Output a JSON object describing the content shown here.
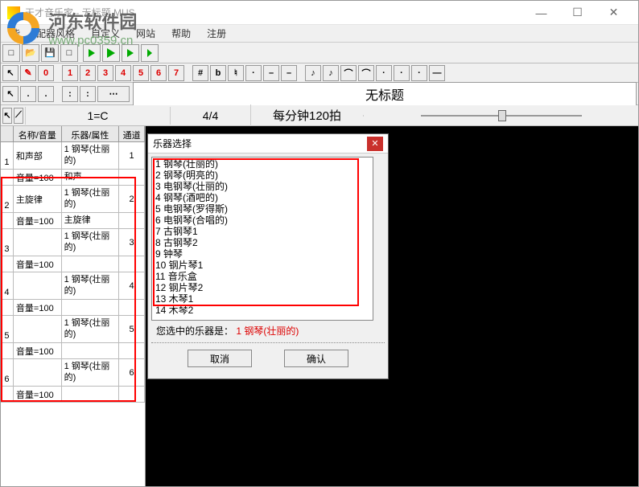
{
  "window": {
    "title": "天才音乐家 - 无标题.MUS"
  },
  "watermark": {
    "cn": "河东软件园",
    "url": "www.pc0359.cn"
  },
  "menu": {
    "m1": "能",
    "m2": "配器风格",
    "m3": "自定义",
    "m4": "网站",
    "m5": "帮助",
    "m6": "注册"
  },
  "toolbar2": {
    "n0": "0",
    "n1": "1",
    "n2": "2",
    "n3": "3",
    "n4": "4",
    "n5": "5",
    "n6": "6",
    "n7": "7",
    "s1": "#",
    "s2": "b",
    "s3": "♮"
  },
  "title_display": "无标题",
  "info": {
    "key": "1=C",
    "ts": "4/4",
    "tempo": "每分钟120拍"
  },
  "grid_header": {
    "c1": "",
    "c2": "名称/音量",
    "c3": "乐器/属性",
    "c4": "通道"
  },
  "tracks": [
    {
      "num": "1",
      "name": "和声部",
      "inst": "1 钢琴(壮丽的)",
      "ch": "1",
      "vol": "音量=100",
      "vname": "和声"
    },
    {
      "num": "2",
      "name": "主旋律",
      "inst": "1 钢琴(壮丽的)",
      "ch": "2",
      "vol": "音量=100",
      "vname": "主旋律"
    },
    {
      "num": "3",
      "name": "",
      "inst": "1 钢琴(壮丽的)",
      "ch": "3",
      "vol": "音量=100",
      "vname": ""
    },
    {
      "num": "4",
      "name": "",
      "inst": "1 钢琴(壮丽的)",
      "ch": "4",
      "vol": "音量=100",
      "vname": ""
    },
    {
      "num": "5",
      "name": "",
      "inst": "1 钢琴(壮丽的)",
      "ch": "5",
      "vol": "音量=100",
      "vname": ""
    },
    {
      "num": "6",
      "name": "",
      "inst": "1 钢琴(壮丽的)",
      "ch": "6",
      "vol": "音量=100",
      "vname": ""
    }
  ],
  "dialog": {
    "title": "乐器选择",
    "items": [
      "1 钢琴(壮丽的)",
      "2 钢琴(明亮的)",
      "3 电钢琴(壮丽的)",
      "4 钢琴(酒吧的)",
      "5 电钢琴(罗得斯)",
      "6 电钢琴(合唱的)",
      "7 古钢琴1",
      "8 古钢琴2",
      "9 钟琴",
      "10 钢片琴1",
      "11 音乐盒",
      "12 钢片琴2",
      "13 木琴1",
      "14 木琴2"
    ],
    "sel_label": "您选中的乐器是：",
    "sel_value": "1 钢琴(壮丽的)",
    "cancel": "取消",
    "ok": "确认"
  }
}
